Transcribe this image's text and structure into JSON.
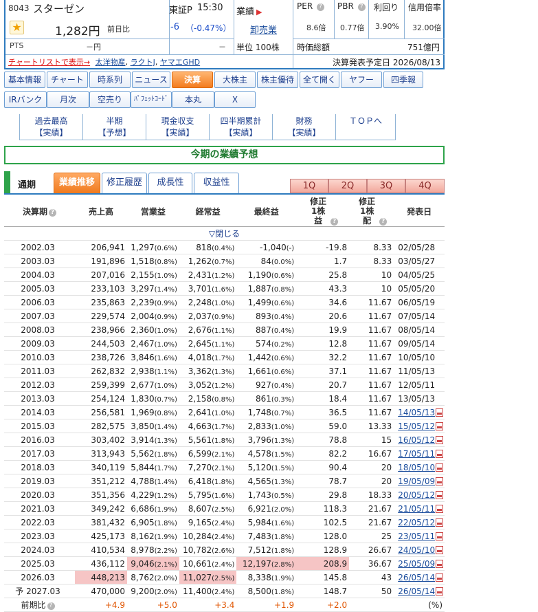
{
  "header": {
    "code": "8043",
    "name": "スターゼン",
    "market": "東証P",
    "time": "15:30",
    "price": "1,282円",
    "change_label": "前日比",
    "change": "-6",
    "change_pct": "（-0.47%）",
    "pts_label": "PTS",
    "pts_value": "－円",
    "pts_change": "－",
    "chartlist_link": "チャートリストで表示→",
    "related": [
      "太洋物産",
      "ラクトJ",
      "ヤマエGHD"
    ],
    "sector_label": "業績",
    "sector_link": "卸売業",
    "unit": "単位 100株",
    "per_label": "PER",
    "per_value": "8.6倍",
    "pbr_label": "PBR",
    "pbr_value": "0.77倍",
    "yield_label": "利回り",
    "yield_value": "3.90%",
    "margin_label": "信用倍率",
    "margin_value": "32.00倍",
    "mcap_label": "時価総額",
    "mcap_value": "751億円",
    "announce": "決算発表予定日 2026/08/13"
  },
  "nav_row1": [
    "基本情報",
    "チャート",
    "時系列",
    "ニュース",
    "決算",
    "大株主",
    "株主優待",
    "全て開く",
    "ヤフー",
    "四季報"
  ],
  "nav_row2": [
    "IRバンク",
    "月次",
    "空売り",
    "ﾊﾟﾌｪｯﾄｺｰﾄﾞ",
    "本丸",
    "X"
  ],
  "subnav": [
    {
      "l1": "過去最高",
      "l2": "【実績】"
    },
    {
      "l1": "半期",
      "l2": "【予想】"
    },
    {
      "l1": "現金収支",
      "l2": "【実績】"
    },
    {
      "l1": "四半期累計",
      "l2": "【実績】"
    },
    {
      "l1": "財務",
      "l2": "【実績】"
    },
    {
      "l1": "ＴＯＰへ",
      "l2": ""
    }
  ],
  "title": "今期の業績予想",
  "tabs": {
    "period_label": "通期",
    "items": [
      "業績推移",
      "修正履歴",
      "成長性",
      "収益性"
    ],
    "quarters": [
      "1Q",
      "2Q",
      "3Q",
      "4Q"
    ]
  },
  "table": {
    "headers": [
      "決算期",
      "売上高",
      "営業益",
      "経常益",
      "最終益",
      "修正1株益",
      "修正1株配",
      "発表日"
    ],
    "collapse_label": "▽閉じる",
    "rows": [
      {
        "p": "2002.03",
        "s": "206,941",
        "o": "1,297",
        "op": "(0.6%)",
        "r": "818",
        "rp": "(0.4%)",
        "n": "-1,040",
        "np": "(-)",
        "e": "-19.8",
        "d": "8.33",
        "dt": "02/05/28"
      },
      {
        "p": "2003.03",
        "s": "191,896",
        "o": "1,518",
        "op": "(0.8%)",
        "r": "1,262",
        "rp": "(0.7%)",
        "n": "84",
        "np": "(0.0%)",
        "e": "1.7",
        "d": "8.33",
        "dt": "03/05/27"
      },
      {
        "p": "2004.03",
        "s": "207,016",
        "o": "2,155",
        "op": "(1.0%)",
        "r": "2,431",
        "rp": "(1.2%)",
        "n": "1,190",
        "np": "(0.6%)",
        "e": "25.8",
        "d": "10",
        "dt": "04/05/25"
      },
      {
        "p": "2005.03",
        "s": "233,103",
        "o": "3,297",
        "op": "(1.4%)",
        "r": "3,701",
        "rp": "(1.6%)",
        "n": "1,887",
        "np": "(0.8%)",
        "e": "43.3",
        "d": "10",
        "dt": "05/05/20"
      },
      {
        "p": "2006.03",
        "s": "235,863",
        "o": "2,239",
        "op": "(0.9%)",
        "r": "2,248",
        "rp": "(1.0%)",
        "n": "1,499",
        "np": "(0.6%)",
        "e": "34.6",
        "d": "11.67",
        "dt": "06/05/19"
      },
      {
        "p": "2007.03",
        "s": "229,574",
        "o": "2,004",
        "op": "(0.9%)",
        "r": "2,037",
        "rp": "(0.9%)",
        "n": "893",
        "np": "(0.4%)",
        "e": "20.6",
        "d": "11.67",
        "dt": "07/05/14"
      },
      {
        "p": "2008.03",
        "s": "238,966",
        "o": "2,360",
        "op": "(1.0%)",
        "r": "2,676",
        "rp": "(1.1%)",
        "n": "887",
        "np": "(0.4%)",
        "e": "19.9",
        "d": "11.67",
        "dt": "08/05/14"
      },
      {
        "p": "2009.03",
        "s": "244,503",
        "o": "2,467",
        "op": "(1.0%)",
        "r": "2,645",
        "rp": "(1.1%)",
        "n": "574",
        "np": "(0.2%)",
        "e": "12.8",
        "d": "11.67",
        "dt": "09/05/14"
      },
      {
        "p": "2010.03",
        "s": "238,726",
        "o": "3,846",
        "op": "(1.6%)",
        "r": "4,018",
        "rp": "(1.7%)",
        "n": "1,442",
        "np": "(0.6%)",
        "e": "32.2",
        "d": "11.67",
        "dt": "10/05/10"
      },
      {
        "p": "2011.03",
        "s": "262,832",
        "o": "2,938",
        "op": "(1.1%)",
        "r": "3,362",
        "rp": "(1.3%)",
        "n": "1,661",
        "np": "(0.6%)",
        "e": "37.1",
        "d": "11.67",
        "dt": "11/05/13"
      },
      {
        "p": "2012.03",
        "s": "259,399",
        "o": "2,677",
        "op": "(1.0%)",
        "r": "3,052",
        "rp": "(1.2%)",
        "n": "927",
        "np": "(0.4%)",
        "e": "20.7",
        "d": "11.67",
        "dt": "12/05/11"
      },
      {
        "p": "2013.03",
        "s": "254,124",
        "o": "1,830",
        "op": "(0.7%)",
        "r": "2,158",
        "rp": "(0.8%)",
        "n": "861",
        "np": "(0.3%)",
        "e": "18.4",
        "d": "11.67",
        "dt": "13/05/13"
      },
      {
        "p": "2014.03",
        "s": "256,581",
        "o": "1,969",
        "op": "(0.8%)",
        "r": "2,641",
        "rp": "(1.0%)",
        "n": "1,748",
        "np": "(0.7%)",
        "e": "36.5",
        "d": "11.67",
        "dt": "14/05/13",
        "link": true
      },
      {
        "p": "2015.03",
        "s": "282,575",
        "o": "3,850",
        "op": "(1.4%)",
        "r": "4,663",
        "rp": "(1.7%)",
        "n": "2,833",
        "np": "(1.0%)",
        "e": "59.0",
        "d": "13.33",
        "dt": "15/05/12",
        "link": true
      },
      {
        "p": "2016.03",
        "s": "303,402",
        "o": "3,914",
        "op": "(1.3%)",
        "r": "5,561",
        "rp": "(1.8%)",
        "n": "3,796",
        "np": "(1.3%)",
        "e": "78.8",
        "d": "15",
        "dt": "16/05/12",
        "link": true
      },
      {
        "p": "2017.03",
        "s": "313,943",
        "o": "5,562",
        "op": "(1.8%)",
        "r": "6,599",
        "rp": "(2.1%)",
        "n": "4,578",
        "np": "(1.5%)",
        "e": "82.2",
        "d": "16.67",
        "dt": "17/05/11",
        "link": true
      },
      {
        "p": "2018.03",
        "s": "340,119",
        "o": "5,844",
        "op": "(1.7%)",
        "r": "7,270",
        "rp": "(2.1%)",
        "n": "5,120",
        "np": "(1.5%)",
        "e": "90.4",
        "d": "20",
        "dt": "18/05/10",
        "link": true
      },
      {
        "p": "2019.03",
        "s": "351,212",
        "o": "4,788",
        "op": "(1.4%)",
        "r": "6,418",
        "rp": "(1.8%)",
        "n": "4,565",
        "np": "(1.3%)",
        "e": "78.7",
        "d": "20",
        "dt": "19/05/09",
        "link": true
      },
      {
        "p": "2020.03",
        "s": "351,356",
        "o": "4,229",
        "op": "(1.2%)",
        "r": "5,795",
        "rp": "(1.6%)",
        "n": "1,743",
        "np": "(0.5%)",
        "e": "29.8",
        "d": "18.33",
        "dt": "20/05/12",
        "link": true
      },
      {
        "p": "2021.03",
        "s": "349,242",
        "o": "6,686",
        "op": "(1.9%)",
        "r": "8,607",
        "rp": "(2.5%)",
        "n": "6,921",
        "np": "(2.0%)",
        "e": "118.3",
        "d": "21.67",
        "dt": "21/05/11",
        "link": true
      },
      {
        "p": "2022.03",
        "s": "381,432",
        "o": "6,905",
        "op": "(1.8%)",
        "r": "9,165",
        "rp": "(2.4%)",
        "n": "5,984",
        "np": "(1.6%)",
        "e": "102.5",
        "d": "21.67",
        "dt": "22/05/12",
        "link": true
      },
      {
        "p": "2023.03",
        "s": "425,173",
        "o": "8,162",
        "op": "(1.9%)",
        "r": "10,284",
        "rp": "(2.4%)",
        "n": "7,483",
        "np": "(1.8%)",
        "e": "128.0",
        "d": "25",
        "dt": "23/05/11",
        "link": true
      },
      {
        "p": "2024.03",
        "s": "410,534",
        "o": "8,978",
        "op": "(2.2%)",
        "r": "10,782",
        "rp": "(2.6%)",
        "n": "7,512",
        "np": "(1.8%)",
        "e": "128.9",
        "d": "26.67",
        "dt": "24/05/10",
        "link": true
      },
      {
        "p": "2025.03",
        "s": "436,112",
        "o": "9,046",
        "op": "(2.1%)",
        "r": "10,661",
        "rp": "(2.4%)",
        "n": "12,197",
        "np": "(2.8%)",
        "e": "208.9",
        "d": "36.67",
        "dt": "25/05/09",
        "link": true,
        "hl": [
          "o",
          "n",
          "e"
        ]
      },
      {
        "p": "2026.03",
        "s": "448,213",
        "o": "8,762",
        "op": "(2.0%)",
        "r": "11,027",
        "rp": "(2.5%)",
        "n": "8,338",
        "np": "(1.9%)",
        "e": "145.8",
        "d": "43",
        "dt": "26/05/14",
        "link": true,
        "hl": [
          "s",
          "r"
        ]
      },
      {
        "p": "予 2027.03",
        "s": "470,000",
        "o": "9,200",
        "op": "(2.0%)",
        "r": "11,400",
        "rp": "(2.4%)",
        "n": "8,500",
        "np": "(1.8%)",
        "e": "148.7",
        "d": "50",
        "dt": "26/05/14",
        "link": true
      }
    ],
    "compare": {
      "label": "前期比",
      "s": "+4.9",
      "o": "+5.0",
      "r": "+3.4",
      "n": "+1.9",
      "e": "+2.0",
      "unit": "(%)"
    }
  }
}
